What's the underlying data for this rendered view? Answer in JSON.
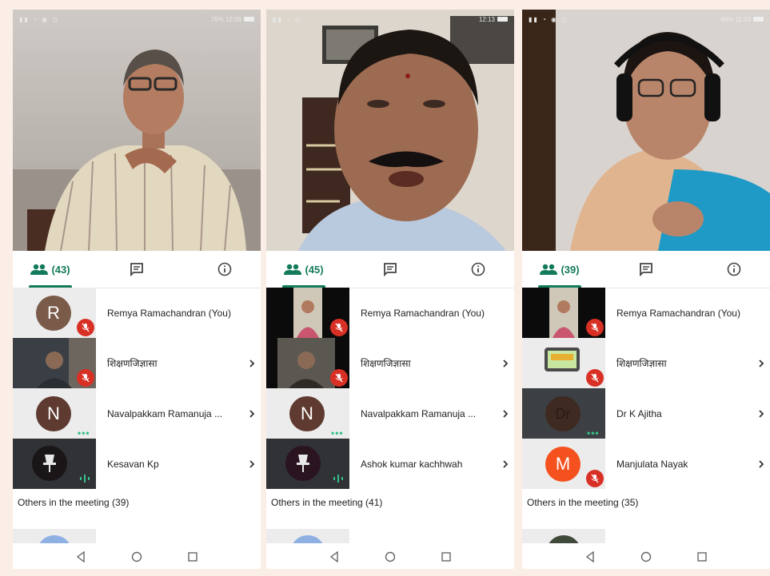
{
  "colors": {
    "accent_green": "#137a5b",
    "mic_off_red": "#d93025",
    "page_bg": "#fbeee6"
  },
  "icons": {
    "people": "people-icon",
    "chat": "chat-icon",
    "info": "info-icon",
    "mic_off": "mic-off-icon",
    "chevron": "chevron-right-icon",
    "nav_back": "nav-back-icon",
    "nav_home": "nav-home-icon",
    "nav_recents": "nav-recents-icon"
  },
  "phones": [
    {
      "status_right": "76% 12:09",
      "people_count": "(43)",
      "participants": [
        {
          "name": "Remya Ramachandran (You)",
          "initial": "R"
        },
        {
          "name": "शिक्षणजिज्ञासा"
        },
        {
          "name": "Navalpakkam Ramanuja ...",
          "initial": "N"
        },
        {
          "name": "Kesavan Kp"
        }
      ],
      "others_label": "Others in the meeting (39)"
    },
    {
      "status_right": "12:13",
      "people_count": "(45)",
      "participants": [
        {
          "name": "Remya Ramachandran (You)"
        },
        {
          "name": "शिक्षणजिज्ञासा"
        },
        {
          "name": "Navalpakkam Ramanuja ...",
          "initial": "N"
        },
        {
          "name": "Ashok kumar kachhwah"
        }
      ],
      "others_label": "Others in the meeting (41)"
    },
    {
      "status_right": "86% 11:33",
      "people_count": "(39)",
      "participants": [
        {
          "name": "Remya Ramachandran (You)"
        },
        {
          "name": "शिक्षणजिज्ञासा"
        },
        {
          "name": "Dr K Ajitha",
          "initial": "Dr"
        },
        {
          "name": "Manjulata Nayak",
          "initial": "M"
        }
      ],
      "others_label": "Others in the meeting (35)"
    }
  ]
}
